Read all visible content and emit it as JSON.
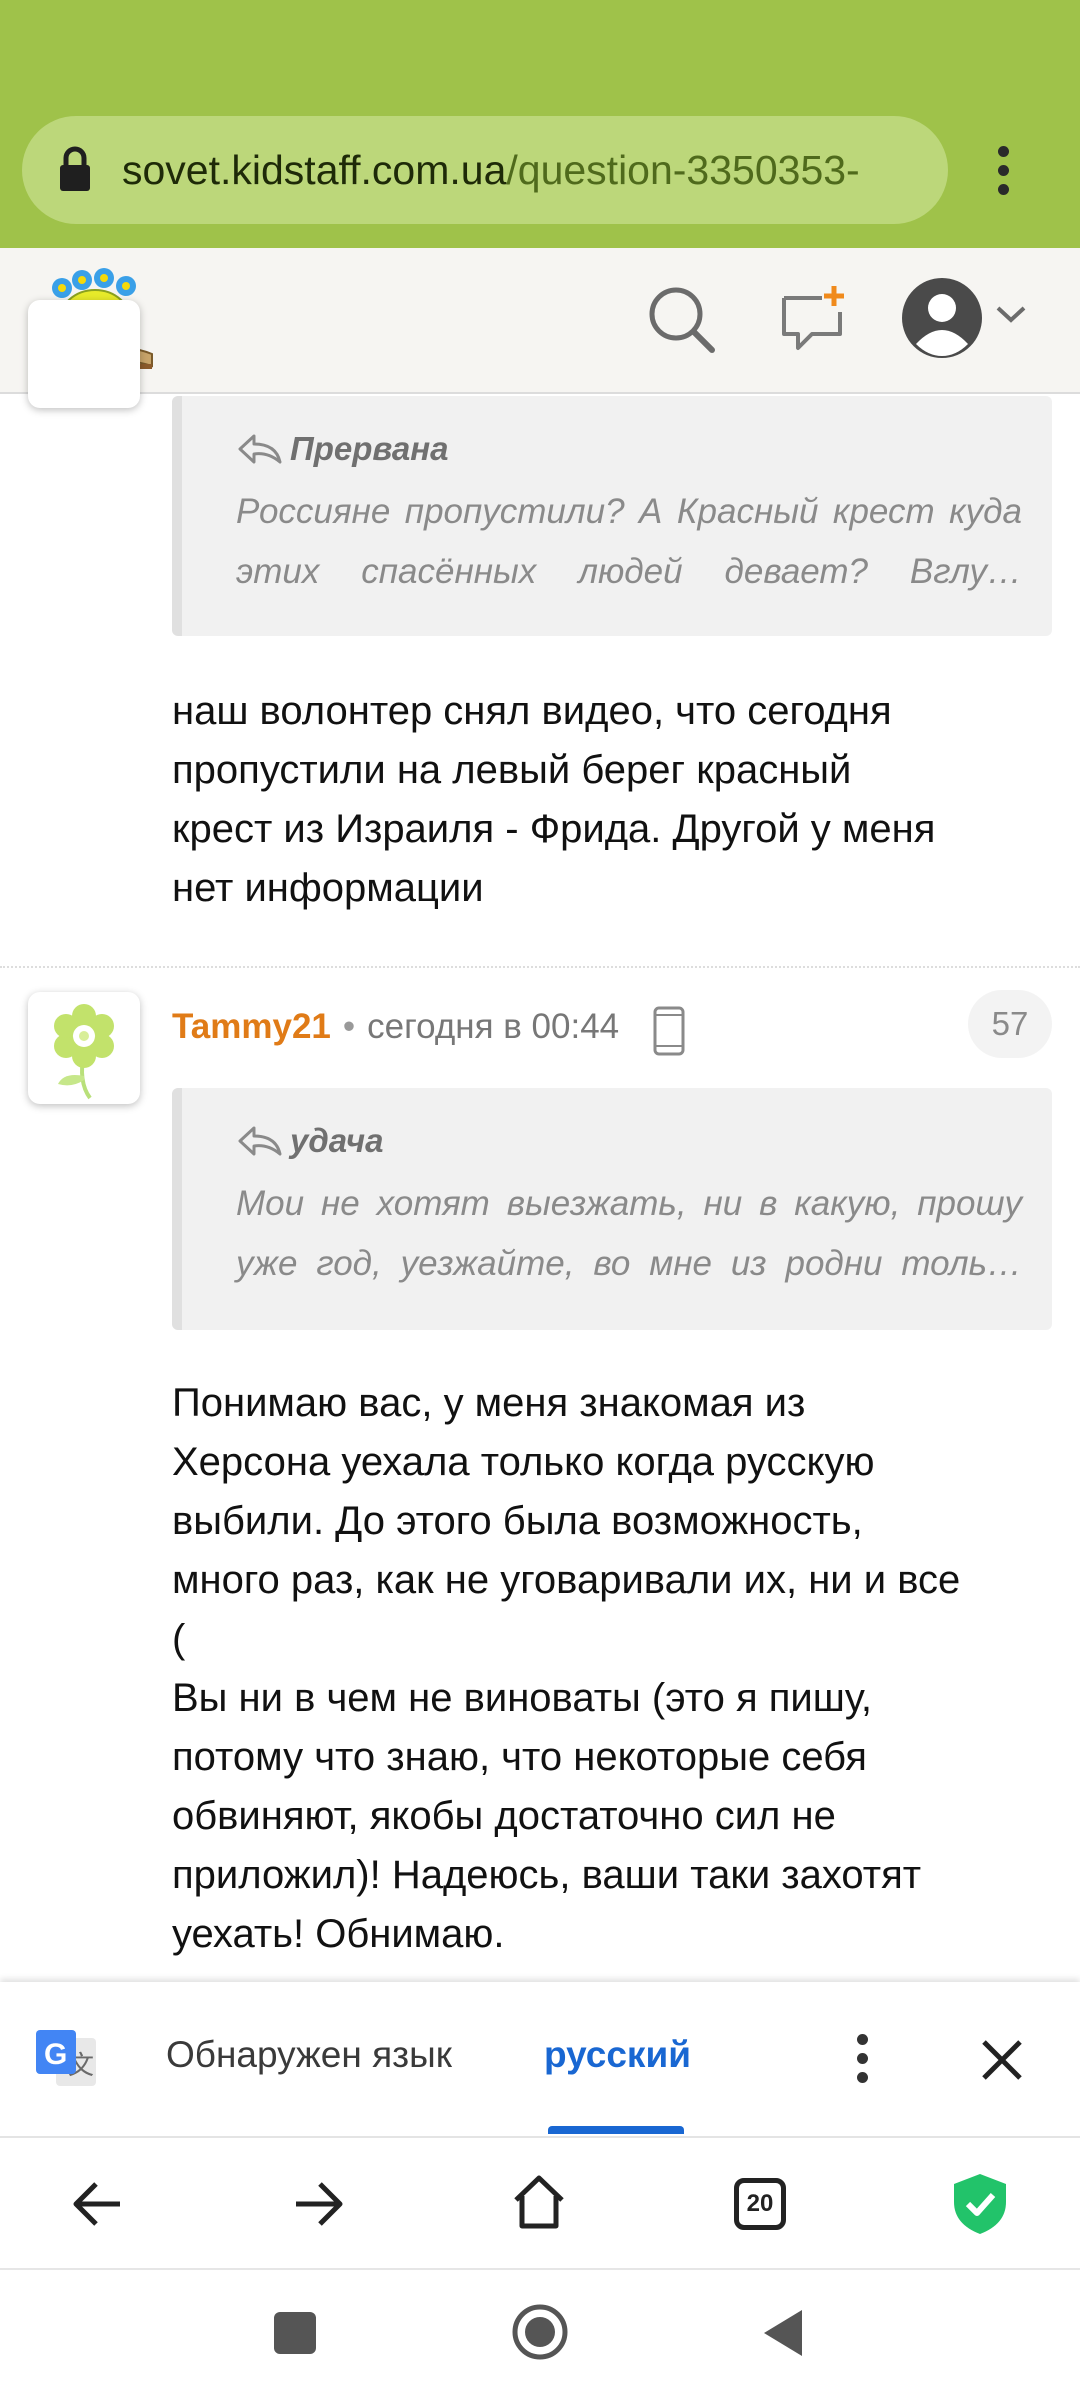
{
  "browser": {
    "url_domain": "sovet.kidstaff.com.ua",
    "url_path": "/question-3350353-",
    "menu_icon": "kebab-menu-icon"
  },
  "site_header": {
    "logo": "kidstaff-logo",
    "icons": [
      "search-icon",
      "new-message-icon",
      "profile-avatar-icon",
      "chevron-down-icon"
    ]
  },
  "posts": [
    {
      "quote": {
        "author": "Прервана",
        "text": "Россияне пропустили? А Красный крест куда этих спасённых людей девает? Вглу…"
      },
      "body": "наш волонтер снял видео, что сегодня\nпропустили на левый берег красный\nкрест из Израиля - Фрида. Другой у меня\nнет информации"
    },
    {
      "username": "Tammy21",
      "separator": "•",
      "time": "сегодня в 00:44",
      "post_number": "57",
      "quote": {
        "author": "удача",
        "text": "Мои не хотят выезжать, ни в какую, прошу уже год, уезжайте, во мне из родни толь…"
      },
      "body": "Понимаю вас, у меня знакомая из\nХерсона уехала только когда русскую\nвыбили. До этого была возможность,\nмного раз, как не уговаривали их, ни и все\n(\nВы ни в чем не виноваты (это я пишу,\nпотому что знаю, что некоторые себя\nобвиняют, якобы достаточно сил не\nприложил)! Надеюсь, ваши таки захотят\nуехать! Обнимаю."
    }
  ],
  "translate_bar": {
    "detected_label": "Обнаружен язык",
    "language": "русский"
  },
  "bottom_nav": {
    "tab_count": "20"
  },
  "colors": {
    "browser_bar": "#9fc24a",
    "username": "#e07b17",
    "translate_accent": "#1967d2",
    "shield": "#22c36a"
  }
}
